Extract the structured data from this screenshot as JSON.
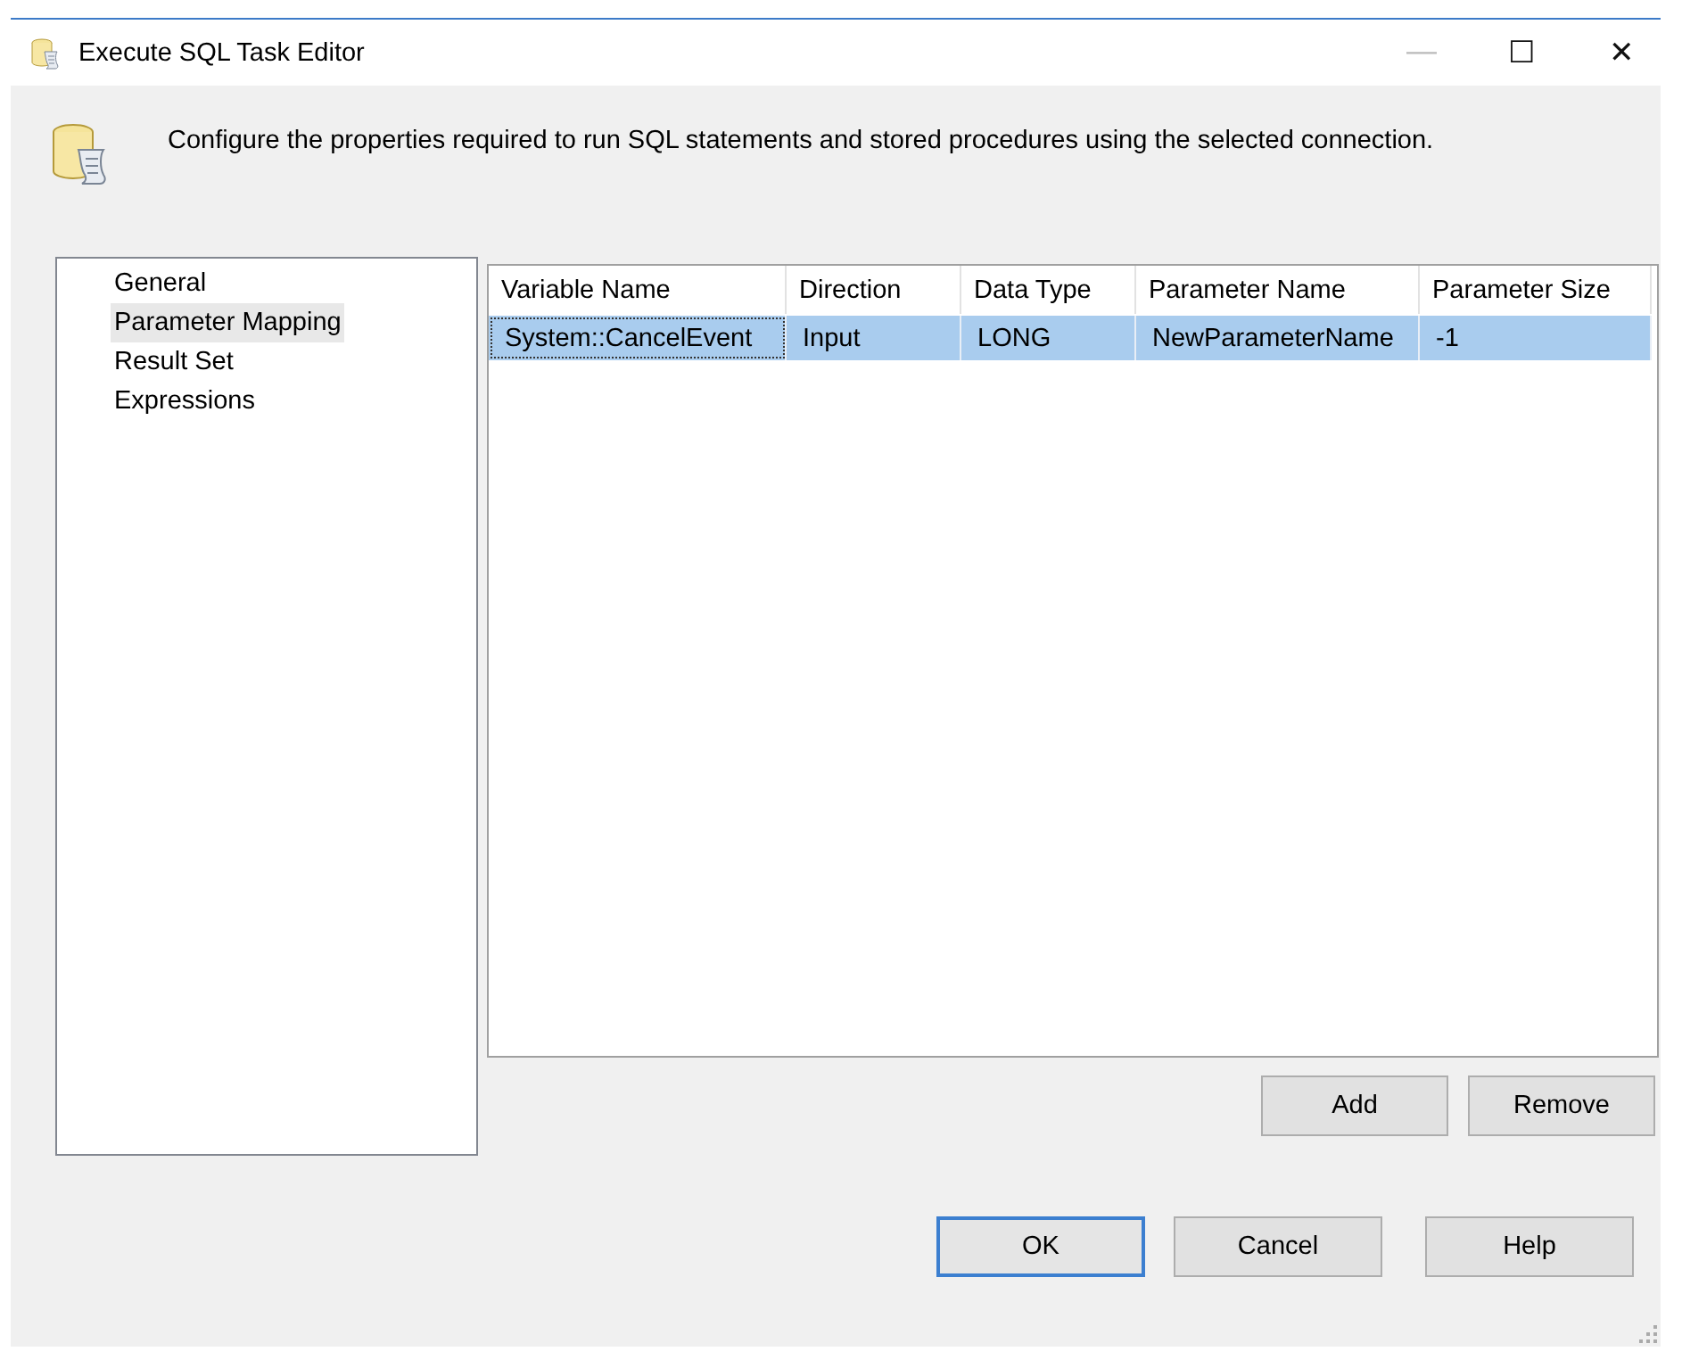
{
  "window": {
    "title": "Execute SQL Task Editor",
    "controls": [
      "—",
      "☐",
      "✕"
    ]
  },
  "header": {
    "description": "Configure the properties required to run SQL statements and stored procedures using the selected connection."
  },
  "sidebar": {
    "items": [
      {
        "label": "General",
        "selected": false
      },
      {
        "label": "Parameter Mapping",
        "selected": true
      },
      {
        "label": "Result Set",
        "selected": false
      },
      {
        "label": "Expressions",
        "selected": false
      }
    ]
  },
  "table": {
    "columns": [
      "Variable Name",
      "Direction",
      "Data Type",
      "Parameter Name",
      "Parameter Size"
    ],
    "rows": [
      {
        "selected": true,
        "cells": [
          {
            "text": "System::CancelEvent",
            "focused": true
          },
          {
            "text": "Input",
            "focused": false
          },
          {
            "text": "LONG",
            "focused": false
          },
          {
            "text": "NewParameterName",
            "focused": false
          },
          {
            "text": "-1",
            "focused": false
          }
        ]
      }
    ]
  },
  "table_buttons": [
    {
      "label": "Add",
      "default": false
    },
    {
      "label": "Remove",
      "default": false
    }
  ],
  "dialog_buttons": [
    {
      "label": "OK",
      "default": true
    },
    {
      "label": "Cancel",
      "default": false
    },
    {
      "label": "Help",
      "default": false
    }
  ]
}
